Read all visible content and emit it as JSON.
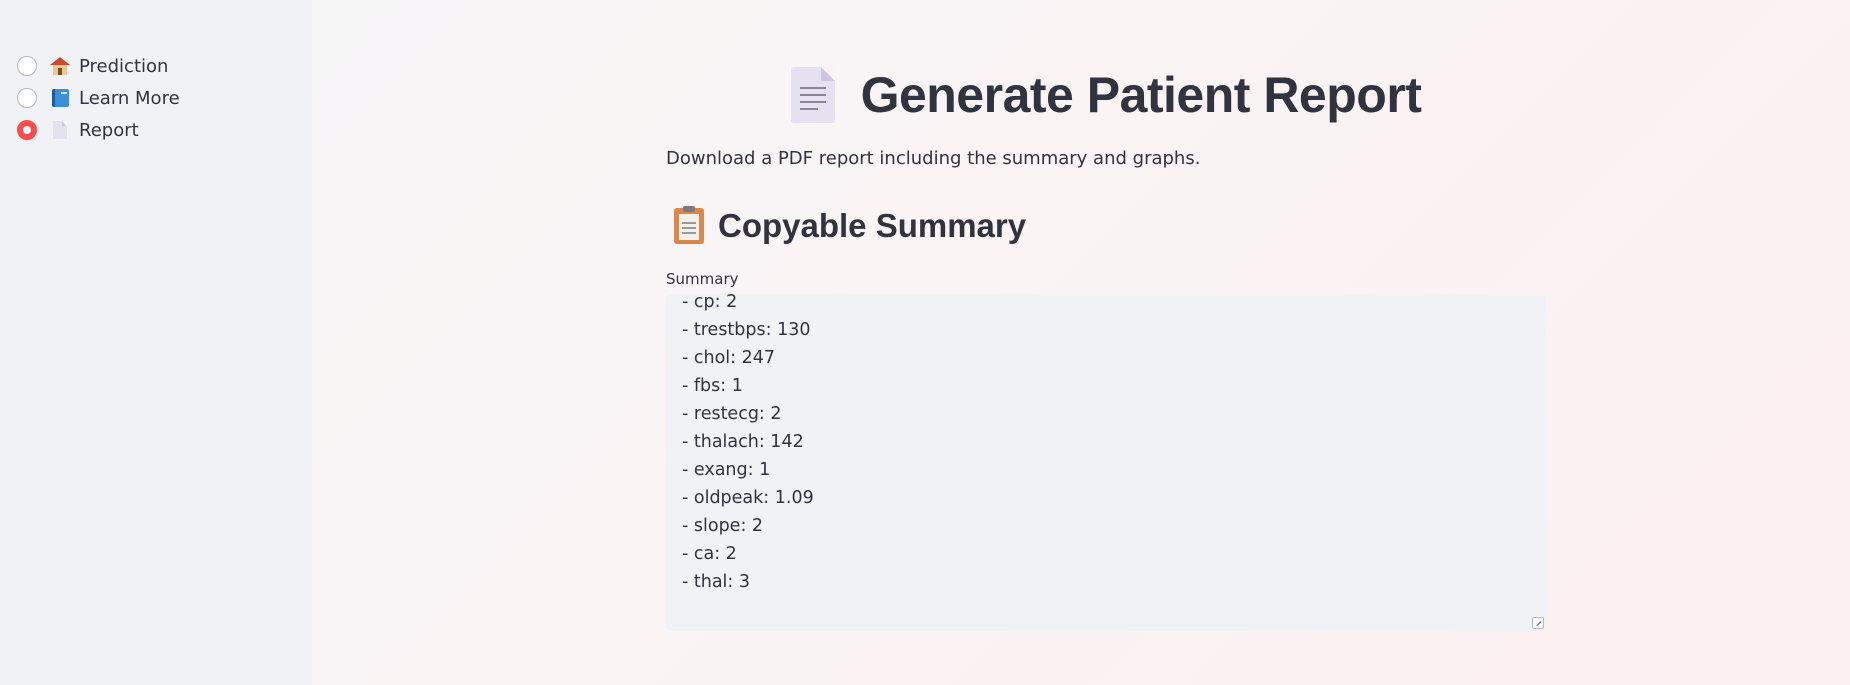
{
  "sidebar": {
    "items": [
      {
        "label": "Prediction",
        "icon": "house-icon",
        "selected": false
      },
      {
        "label": "Learn More",
        "icon": "book-icon",
        "selected": false
      },
      {
        "label": "Report",
        "icon": "document-icon",
        "selected": true
      }
    ]
  },
  "main": {
    "title": "Generate Patient Report",
    "title_icon": "document-icon",
    "description": "Download a PDF report including the summary and graphs.",
    "section_title": "Copyable Summary",
    "section_icon": "clipboard-icon",
    "summary_label": "Summary",
    "summary_lines": [
      "- cp: 2",
      "- trestbps: 130",
      "- chol: 247",
      "- fbs: 1",
      "- restecg: 2",
      "- thalach: 142",
      "- exang: 1",
      "- oldpeak: 1.09",
      "- slope: 2",
      "- ca: 2",
      "- thal: 3"
    ]
  },
  "colors": {
    "accent": "#ff4b4b",
    "sidebar_bg": "#f0f2f6",
    "text": "#31333f"
  }
}
